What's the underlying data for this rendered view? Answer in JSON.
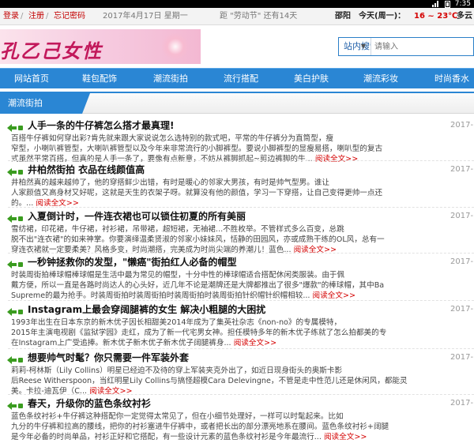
{
  "status_bar": {
    "time": "7:35"
  },
  "top_bar": {
    "login": "登录",
    "sep1": " / ",
    "register": "注册",
    "sep2": " / ",
    "forgot": "忘记密码",
    "date": "2017年4月17日 星期一",
    "countdown": "距 \"劳动节\" 还有14天",
    "city": "邵阳",
    "weather": "今天(周一)：",
    "temp": "16 ~ 23℃",
    "weather_desc": "多云"
  },
  "header": {
    "logo_text": "孔乙己女性",
    "search_select": "站内搜索(标题)",
    "search_placeholder": "请输入"
  },
  "nav": [
    "网站首页",
    "鞋包配饰",
    "潮流街拍",
    "流行搭配",
    "美白护肤",
    "潮流彩妆",
    "时尚香水"
  ],
  "section": {
    "title": "潮流街拍"
  },
  "colors": {
    "nav_bg": "#2a86d4",
    "link_red": "#d40000",
    "icon_green": "#3a9c1f"
  },
  "read_more": "阅读全文>>",
  "articles": [
    {
      "title": "人手一条的牛仔裤怎么搭才最真理!",
      "date": "2017-",
      "lines": [
        "百搭牛仔裤如何穿出彩?肯先就来跟大家说说怎么选特别的款式吧，平常的牛仔裤分为直筒型，瘦",
        "窄型，小喇叭裤管型，大喇叭裤管型以及今年来非常流行的小脚裤型。要说小脚裤型的显瘦易搭，喇叭型的复古",
        "式虽然平常百搭，但真的是人手一条了，要像有点新意，不妨从裤脚抓起~剪边裤脚的牛..."
      ]
    },
    {
      "title": "井柏然街拍 衣品在线颜值高",
      "date": "2017-",
      "lines": [
        "井柏然真的越来越帅了，他的穿搭鲜少出错，有时是暖心的邻家大男孩，有时是帅气型男。谁让",
        "人家颜值又高身材又好呢，这就是天生的衣架子呀。就算没有他的颜值，学习一下穿搭，让自己变得更帅一点还",
        "的。..."
      ]
    },
    {
      "title": "入夏倒计时，一件连衣裙也可以锁住初夏的所有美丽",
      "date": "2017-",
      "lines": [
        "雪纺裙，印花裙，牛仔裙，衬衫裙，吊带裙，超短裙，无袖裙...不胜枚举。不管样式多么百变，总跳",
        "脱不出\"连衣裙\"的如来神掌。你要演绎温柔贤淑的邻家小妹妹风，恬静的田园风，亦或成熟干练的OL风，总有一",
        "穿连衣裙就一定要柔美？风格多变，时尚潮搭，完美成为时尚尖端的养潮儿！蓝色..."
      ]
    },
    {
      "title": "一秒钟拯救你的发型，\"懒癌\"街拍红人必备的帽型",
      "date": "2017-",
      "lines": [
        "时装周街拍棒球帽棒球帽是生活中最为常见的帽型，十分中性的棒球帽适合搭配休闲类服装。由于佩",
        "戴方便，所以一直是各路时尚达人的心头好，近几年不论是潮牌还是大牌都推出了很多\"爆款\"的棒球帽，其中Ba",
        "Supreme的最为抢手。时装周街拍时装周街拍时装周街拍时装周街拍针织帽针织帽相较..."
      ]
    },
    {
      "title": "Instagram上最会穿阔腿裤的女生 解决小粗腿的大困扰",
      "date": "2017-",
      "lines": [
        "1993年出生在日本东京的新木优子因长相甜美2014年成为了集英社杂志《non-no》的专属模特，",
        "2015年主演电视剧《监狱学园》走红，成为了新一代宅男女神。担任模特多年的新木优子练就了怎么拍都美的专",
        "在Instagram上广受追捧。新木优子新木优子新木优子阔腿裤身..."
      ]
    },
    {
      "title": "想要帅气时髦？你只需要一件军装外套",
      "date": "2017-",
      "lines": [
        "莉莉-柯林斯（Lily Collins）明星已经迫不及待的穿上军装夹克外出了，如近日现身街头的奥斯卡影",
        "后Reese Witherspoon，当红明星Lily Collins与搞怪超模Cara Delevingne，不管是走中性范儿还是休闲风，都能灵",
        "美。卡拉-迪瓦伊（C..."
      ]
    },
    {
      "title": "春天，升级你的蓝色条纹衬衫",
      "date": "2017-",
      "lines": [
        "蓝色条纹衬衫+牛仔裤这种搭配你一定觉得太常见了，但在小细节处理好，一样可以时髦起来。比如",
        "九分的牛仔裤和拉高的腰线，把你的衬衫塞进牛仔裤中，或者把长出的部分漂亮地系在腰间。蓝色条纹衬衫+阔腿",
        "是今年必备的时尚单品，衬衫正好和它搭配，有一些设计元素的蓝色条纹衬衫是今年最流行..."
      ]
    }
  ]
}
